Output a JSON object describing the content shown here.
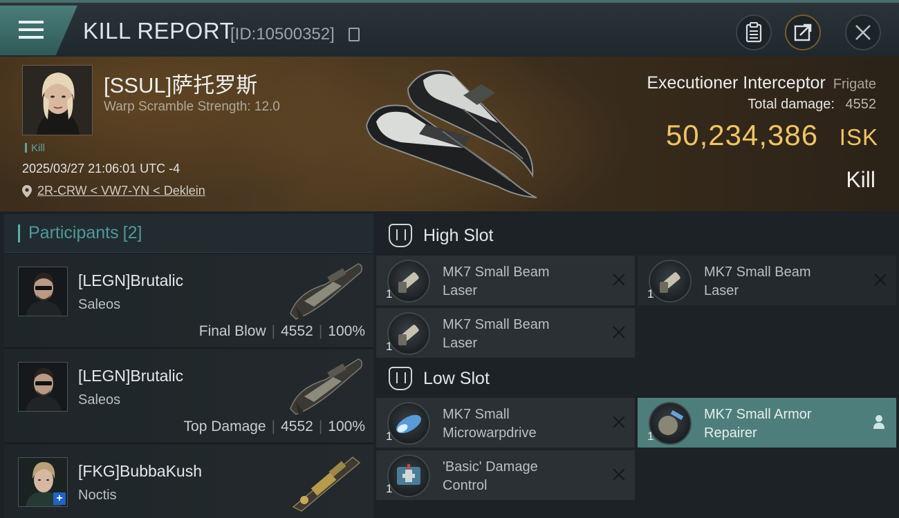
{
  "topbar": {
    "title": "KILL REPORT",
    "report_id": "[ID:10500352]"
  },
  "victim": {
    "pilot_name": "[SSUL]萨托罗斯",
    "warp_scramble": "Warp Scramble Strength: 12.0",
    "tag": "Kill",
    "timestamp": "2025/03/27 21:06:01 UTC -4",
    "location": "2R-CRW < VW7-YN < Deklein",
    "ship_name": "Executioner Interceptor",
    "ship_class": "Frigate",
    "damage_label": "Total damage:",
    "damage_value": "4552",
    "isk_value": "50,234,386",
    "isk_unit": "ISK",
    "result": "Kill"
  },
  "participants": {
    "header": "Participants",
    "count": "[2]",
    "items": [
      {
        "name": "[LEGN]Brutalic",
        "ship": "Saleos",
        "role": "Final Blow",
        "damage": "4552",
        "percent": "100%"
      },
      {
        "name": "[LEGN]Brutalic",
        "ship": "Saleos",
        "role": "Top Damage",
        "damage": "4552",
        "percent": "100%"
      },
      {
        "name": "[FKG]BubbaKush",
        "ship": "Noctis"
      }
    ]
  },
  "slots": {
    "high": {
      "title": "High Slot",
      "modules": [
        {
          "line1": "MK7 Small Beam",
          "line2": "Laser",
          "qty": "1"
        },
        {
          "line1": "MK7 Small Beam",
          "line2": "Laser",
          "qty": "1"
        },
        {
          "line1": "MK7 Small Beam",
          "line2": "Laser",
          "qty": "1"
        }
      ]
    },
    "low": {
      "title": "Low Slot",
      "modules": [
        {
          "line1": "MK7 Small",
          "line2": "Microwarpdrive",
          "qty": "1"
        },
        {
          "line1": "MK7 Small Armor",
          "line2": "Repairer",
          "qty": "1"
        },
        {
          "line1": "'Basic' Damage",
          "line2": "Control",
          "qty": "1"
        }
      ]
    }
  },
  "colors": {
    "accent_teal": "#4e9a9a",
    "isk_gold": "#f0c466",
    "active_module": "#4e7e7b"
  },
  "icons": [
    "menu-icon",
    "copy-icon",
    "clipboard-icon",
    "share-icon",
    "close-icon",
    "location-pin-icon",
    "high-slot-icon",
    "low-slot-icon",
    "remove-icon",
    "person-icon"
  ]
}
